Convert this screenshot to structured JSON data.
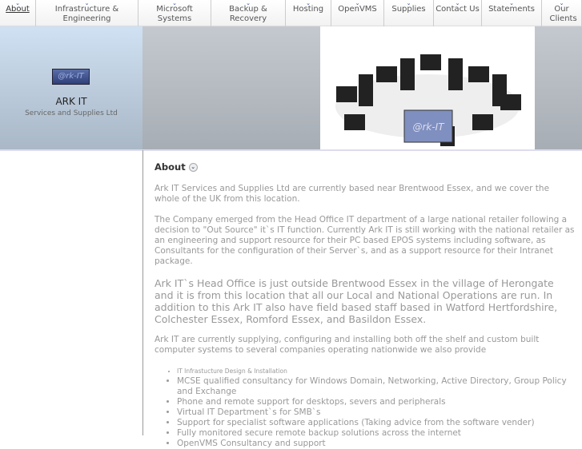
{
  "nav": [
    "About",
    "Infrastructure & Engineering",
    "Microsoft Systems",
    "Backup & Recovery",
    "Hosting",
    "OpenVMS",
    "Supplies",
    "Contact Us",
    "Statements",
    "Our Clients"
  ],
  "header": {
    "logo_text": "@rk-IT",
    "brand": "ARK IT",
    "tagline": "Services and Supplies Ltd"
  },
  "main": {
    "title": "About",
    "p1": "Ark IT Services and Supplies Ltd are currently based near Brentwood Essex, and we cover the whole of the UK from this location.",
    "p2": "The Company emerged from the Head Office IT department of a large national retailer following a decision to \"Out Source\" it`s IT function. Currently Ark IT is still working with the national retailer as an engineering and support resource for their PC based EPOS systems including software, as Consultants for the configuration of their Server`s, and as a support resource for their Intranet package.",
    "p3": "Ark IT`s Head Office is just outside Brentwood Essex in the village of Herongate and it is from this location that all our Local and National Operations are run. In addition to this Ark IT also have field based staff based in Watford Hertfordshire, Colchester Essex, Romford Essex, and Basildon Essex.",
    "p4": "Ark IT are currently supplying, configuring and installing both off the shelf and custom built computer systems to several companies operating nationwide we also provide",
    "services": [
      "IT Infrastucture Design & Installation",
      "MCSE qualified consultancy for Windows Domain, Networking, Active Directory, Group Policy and Exchange",
      "Phone and remote support for desktops, severs and peripherals",
      "Virtual IT Department`s for SMB`s",
      "Support for specialist software applications (Taking advice from the software vender)",
      "Fully monitored secure remote backup solutions across the internet",
      "OpenVMS Consultancy and support"
    ]
  }
}
